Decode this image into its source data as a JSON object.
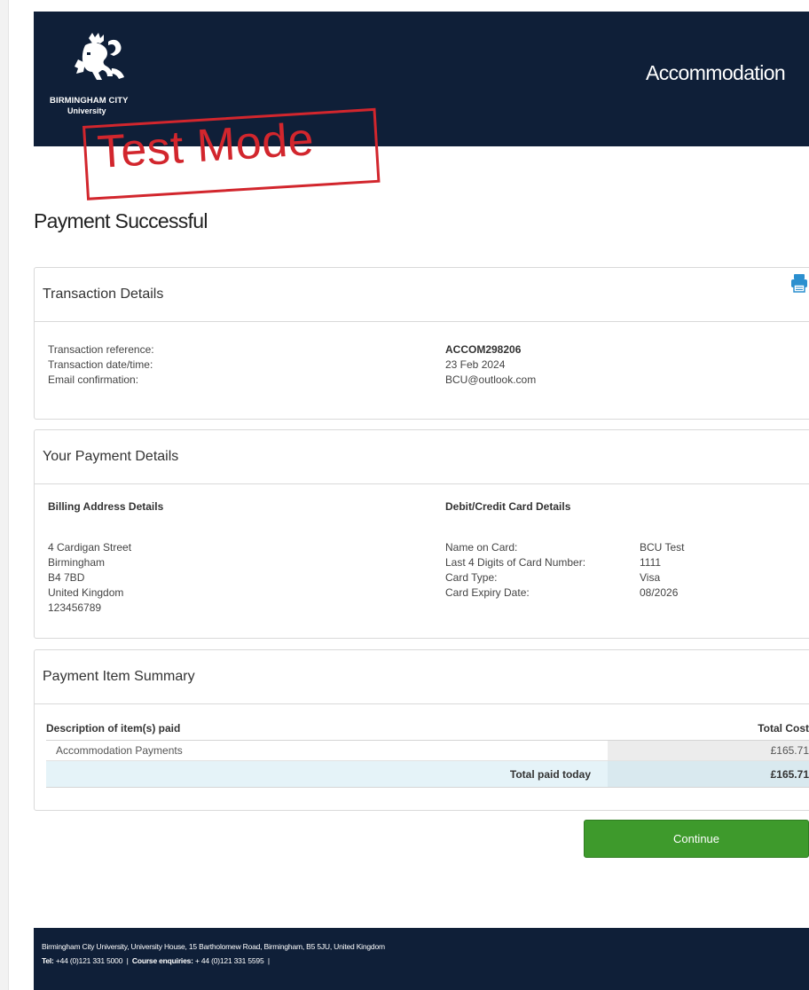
{
  "header": {
    "logo_line1": "BIRMINGHAM CITY",
    "logo_line2": "University",
    "title": "Accommodation"
  },
  "stamp": "Test Mode",
  "page_title": "Payment Successful",
  "transaction": {
    "heading": "Transaction Details",
    "print_icon": "printer-icon",
    "labels": [
      "Transaction reference:",
      "Transaction date/time:",
      "Email confirmation:"
    ],
    "reference": "ACCOM298206",
    "datetime": "23 Feb 2024",
    "email": "BCU@outlook.com"
  },
  "payment": {
    "heading": "Your Payment Details",
    "billing_heading": "Billing Address Details",
    "billing_lines": [
      "4 Cardigan Street",
      "Birmingham",
      "B4 7BD",
      "United Kingdom",
      "123456789"
    ],
    "card_heading": "Debit/Credit Card Details",
    "card_labels": [
      "Name on Card:",
      "Last 4 Digits of Card Number:",
      "Card Type:",
      "Card Expiry Date:"
    ],
    "card_values": [
      "BCU Test",
      "1111",
      "Visa",
      "08/2026"
    ]
  },
  "summary": {
    "heading": "Payment Item Summary",
    "col_description": "Description of item(s) paid",
    "col_total": "Total Cost",
    "item_description": "Accommodation Payments",
    "item_cost": "£165.71",
    "total_label": "Total paid today",
    "total_value": "£165.71"
  },
  "continue_label": "Continue",
  "footer": {
    "address": "Birmingham City University, University House, 15 Bartholomew Road, Birmingham, B5 5JU, United Kingdom",
    "tel_label": "Tel:",
    "tel_value": "+44 (0)121 331 5000",
    "separator": "|",
    "enquiries_label": "Course enquiries:",
    "enquiries_value": "+ 44 (0)121 331 5595"
  },
  "colors": {
    "header_bg": "#0f1f38",
    "stamp": "#d2262d",
    "continue_bg": "#3e9a2c",
    "highlight_row": "#e5f3f8",
    "print_icon": "#2b8fcf"
  }
}
